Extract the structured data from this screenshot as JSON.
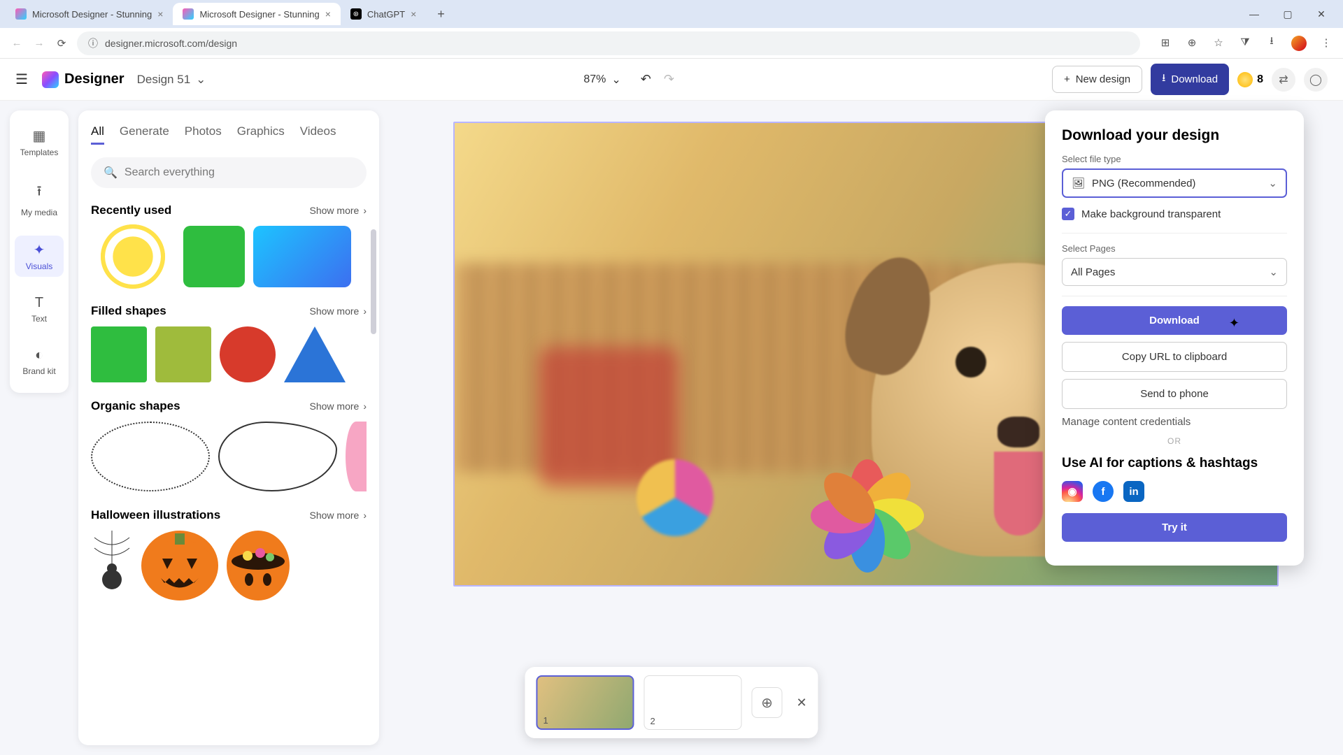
{
  "browser": {
    "tabs": [
      {
        "title": "Microsoft Designer - Stunning",
        "favicon_bg": "linear-gradient(135deg,#ff5ab5,#2bd4ff)"
      },
      {
        "title": "Microsoft Designer - Stunning",
        "favicon_bg": "linear-gradient(135deg,#ff5ab5,#2bd4ff)"
      },
      {
        "title": "ChatGPT",
        "favicon_bg": "#000"
      }
    ],
    "active_tab_index": 1,
    "url": "designer.microsoft.com/design"
  },
  "app_bar": {
    "brand": "Designer",
    "design_name": "Design 51",
    "zoom": "87%",
    "new_design": "New design",
    "download": "Download",
    "credits": "8"
  },
  "rail": {
    "items": [
      "Templates",
      "My media",
      "Visuals",
      "Text",
      "Brand kit"
    ],
    "active_index": 2
  },
  "panel": {
    "tabs": [
      "All",
      "Generate",
      "Photos",
      "Graphics",
      "Videos"
    ],
    "active_tab_index": 0,
    "search_placeholder": "Search everything",
    "sections": {
      "recently_used": {
        "title": "Recently used",
        "show_more": "Show more"
      },
      "filled_shapes": {
        "title": "Filled shapes",
        "show_more": "Show more"
      },
      "organic_shapes": {
        "title": "Organic shapes",
        "show_more": "Show more"
      },
      "halloween": {
        "title": "Halloween illustrations",
        "show_more": "Show more"
      }
    }
  },
  "popover": {
    "title": "Download your design",
    "file_type_label": "Select file type",
    "file_type_value": "PNG (Recommended)",
    "transparent_label": "Make background transparent",
    "transparent_checked": true,
    "pages_label": "Select Pages",
    "pages_value": "All Pages",
    "download_btn": "Download",
    "copy_url_btn": "Copy URL to clipboard",
    "send_phone_btn": "Send to phone",
    "manage_link": "Manage content credentials",
    "or": "OR",
    "ai_title": "Use AI for captions & hashtags",
    "try_it": "Try it"
  },
  "page_tray": {
    "pages": [
      "1",
      "2"
    ],
    "selected_index": 0
  },
  "colors": {
    "primary": "#5b5fd6",
    "primary_dark": "#323b9f"
  }
}
